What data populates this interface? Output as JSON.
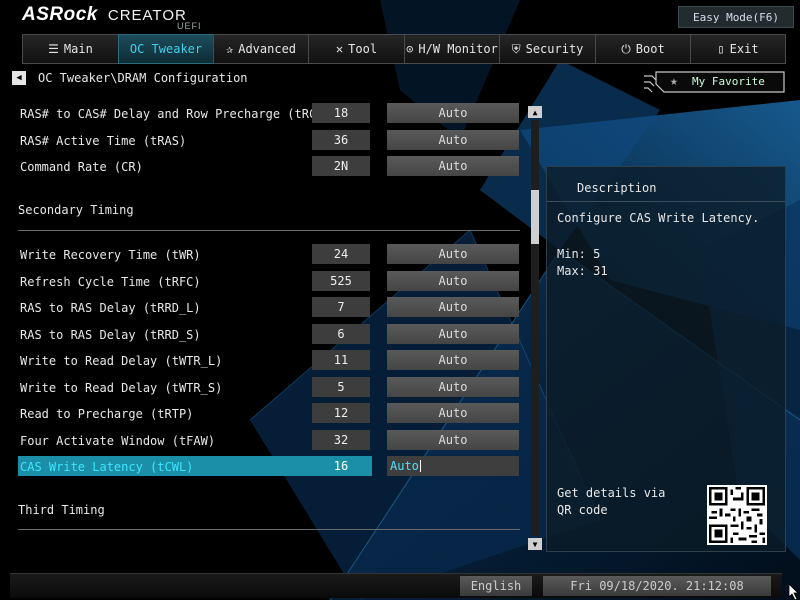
{
  "header": {
    "brand": "ASRock",
    "product": "CREATOR",
    "uefi": "UEFI",
    "easy_mode": "Easy Mode(F6)"
  },
  "tabs": [
    {
      "label": "Main",
      "icon": "list-icon"
    },
    {
      "label": "OC Tweaker",
      "icon": "none"
    },
    {
      "label": "Advanced",
      "icon": "star-icon"
    },
    {
      "label": "Tool",
      "icon": "tools-icon"
    },
    {
      "label": "H/W Monitor",
      "icon": "monitor-icon"
    },
    {
      "label": "Security",
      "icon": "shield-icon"
    },
    {
      "label": "Boot",
      "icon": "power-icon"
    },
    {
      "label": "Exit",
      "icon": "exit-icon"
    }
  ],
  "breadcrumb": "OC Tweaker\\DRAM Configuration",
  "favorite": "My Favorite",
  "rows_top": [
    {
      "label": "RAS# to CAS# Delay and Row Precharge (tRCDtRP)",
      "value": "18",
      "option": "Auto"
    },
    {
      "label": "RAS# Active Time (tRAS)",
      "value": "36",
      "option": "Auto"
    },
    {
      "label": "Command Rate (CR)",
      "value": "2N",
      "option": "Auto"
    }
  ],
  "section_secondary": "Secondary Timing",
  "rows_secondary": [
    {
      "label": "Write Recovery Time (tWR)",
      "value": "24",
      "option": "Auto"
    },
    {
      "label": "Refresh Cycle Time (tRFC)",
      "value": "525",
      "option": "Auto"
    },
    {
      "label": "RAS to RAS Delay (tRRD_L)",
      "value": "7",
      "option": "Auto"
    },
    {
      "label": "RAS to RAS Delay (tRRD_S)",
      "value": "6",
      "option": "Auto"
    },
    {
      "label": "Write to Read Delay (tWTR_L)",
      "value": "11",
      "option": "Auto"
    },
    {
      "label": "Write to Read Delay (tWTR_S)",
      "value": "5",
      "option": "Auto"
    },
    {
      "label": "Read to Precharge (tRTP)",
      "value": "12",
      "option": "Auto"
    },
    {
      "label": "Four Activate Window (tFAW)",
      "value": "32",
      "option": "Auto"
    },
    {
      "label": "CAS Write Latency (tCWL)",
      "value": "16",
      "option": "Auto"
    }
  ],
  "section_third": "Third Timing",
  "description": {
    "title": "Description",
    "text": "Configure CAS Write Latency.",
    "min": "Min: 5",
    "max": "Max: 31",
    "qr_text": "Get details via QR code"
  },
  "footer": {
    "language": "English",
    "datetime": "Fri 09/18/2020. 21:12:08"
  }
}
